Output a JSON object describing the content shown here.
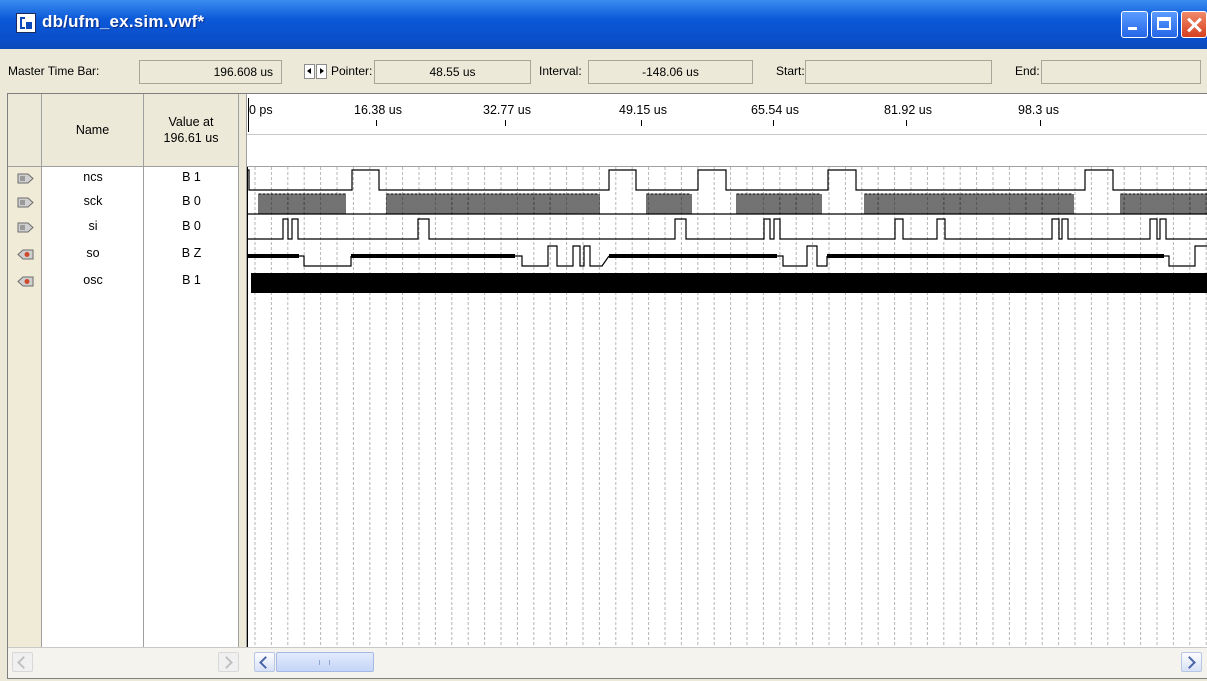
{
  "window": {
    "title": "db/ufm_ex.sim.vwf*"
  },
  "toolbar": {
    "master_time_bar_label": "Master Time Bar:",
    "master_time_bar_value": "196.608 us",
    "pointer_label": "Pointer:",
    "pointer_value": "48.55 us",
    "interval_label": "Interval:",
    "interval_value": "-148.06 us",
    "start_label": "Start:",
    "start_value": "",
    "end_label": "End:",
    "end_value": ""
  },
  "columns": {
    "name_header": "Name",
    "value_header_line1": "Value at",
    "value_header_line2": "196.61 us"
  },
  "timeline": {
    "ticks": [
      "0 ps",
      "16.38 us",
      "32.77 us",
      "49.15 us",
      "65.54 us",
      "81.92 us",
      "98.3 us"
    ],
    "visible_range_us": [
      0,
      114.7
    ]
  },
  "signals": [
    {
      "name": "ncs",
      "value": "B 1",
      "direction": "input"
    },
    {
      "name": "sck",
      "value": "B 0",
      "direction": "input"
    },
    {
      "name": "si",
      "value": "B 0",
      "direction": "input"
    },
    {
      "name": "so",
      "value": "B Z",
      "direction": "output"
    },
    {
      "name": "osc",
      "value": "B 1",
      "direction": "output"
    }
  ],
  "colors": {
    "titlebar": "#0b58d8",
    "chrome": "#ece9d8",
    "waveform": "#000000",
    "grid": "#b0b0b0"
  }
}
